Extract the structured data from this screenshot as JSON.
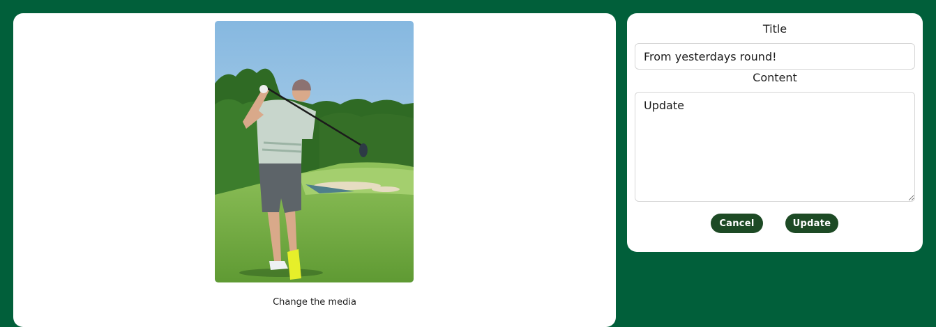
{
  "media": {
    "image_alt": "Golfer finishing a tee shot on a green fairway",
    "change_label": "Change the media"
  },
  "form": {
    "title_label": "Title",
    "title_value": "From yesterdays round!",
    "content_label": "Content",
    "content_value": "Update",
    "cancel_label": "Cancel",
    "update_label": "Update"
  },
  "colors": {
    "page_background": "#015f3a",
    "button_background": "#1d4a25",
    "card_background": "#ffffff"
  }
}
